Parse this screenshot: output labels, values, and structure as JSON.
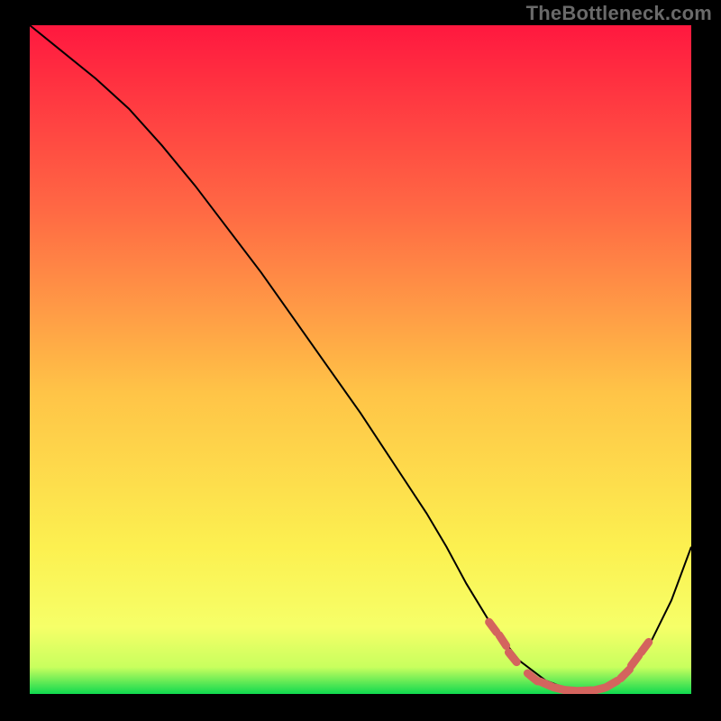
{
  "watermark": "TheBottleneck.com",
  "colors": {
    "gradient_top": "#ff183f",
    "gradient_mid_upper": "#ff6a44",
    "gradient_mid": "#ffc447",
    "gradient_mid_lower": "#fcf050",
    "gradient_lower": "#f6ff68",
    "gradient_green": "#0fd94f",
    "curve": "#000000",
    "marker": "#d4645e"
  },
  "chart_data": {
    "type": "line",
    "title": "",
    "xlabel": "",
    "ylabel": "",
    "xlim": [
      0,
      100
    ],
    "ylim": [
      0,
      100
    ],
    "series": [
      {
        "name": "bottleneck-curve",
        "x": [
          0,
          5,
          10,
          15,
          20,
          25,
          30,
          35,
          40,
          45,
          50,
          55,
          60,
          63,
          66,
          70,
          74,
          78,
          82,
          86,
          90,
          94,
          97,
          100
        ],
        "y": [
          100,
          96,
          92,
          87.5,
          82,
          76,
          69.5,
          63,
          56,
          49,
          42,
          34.5,
          27,
          22,
          16.5,
          10,
          5,
          2,
          0.5,
          0.5,
          2.5,
          8,
          14,
          22
        ]
      }
    ],
    "highlighted_range": {
      "name": "optimal-zone-markers",
      "x_start": 70,
      "x_end": 93,
      "marker_points": [
        {
          "x": 70,
          "y": 10
        },
        {
          "x": 71.5,
          "y": 8
        },
        {
          "x": 73,
          "y": 5.5
        },
        {
          "x": 76,
          "y": 2.5
        },
        {
          "x": 78,
          "y": 1.5
        },
        {
          "x": 80,
          "y": 0.8
        },
        {
          "x": 82,
          "y": 0.5
        },
        {
          "x": 84,
          "y": 0.5
        },
        {
          "x": 86,
          "y": 0.7
        },
        {
          "x": 88,
          "y": 1.5
        },
        {
          "x": 90,
          "y": 3
        },
        {
          "x": 91.5,
          "y": 5
        },
        {
          "x": 93,
          "y": 7
        }
      ]
    }
  }
}
